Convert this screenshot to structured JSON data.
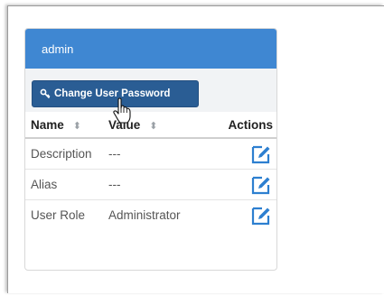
{
  "panel": {
    "title": "admin",
    "change_password_label": "Change User Password"
  },
  "table": {
    "columns": [
      "Name",
      "Value",
      "Actions"
    ],
    "rows": [
      {
        "name": "Description",
        "value": "---"
      },
      {
        "name": "Alias",
        "value": "---"
      },
      {
        "name": "User Role",
        "value": "Administrator"
      }
    ]
  },
  "colors": {
    "header_bg": "#3f87d2",
    "button_bg": "#2a5d94",
    "edit_icon": "#2d7fd0"
  },
  "icons": {
    "button_icon": "key-icon",
    "sort_icon": "sort-icon",
    "edit_icon": "edit-icon",
    "cursor": "hand-pointer-icon"
  }
}
